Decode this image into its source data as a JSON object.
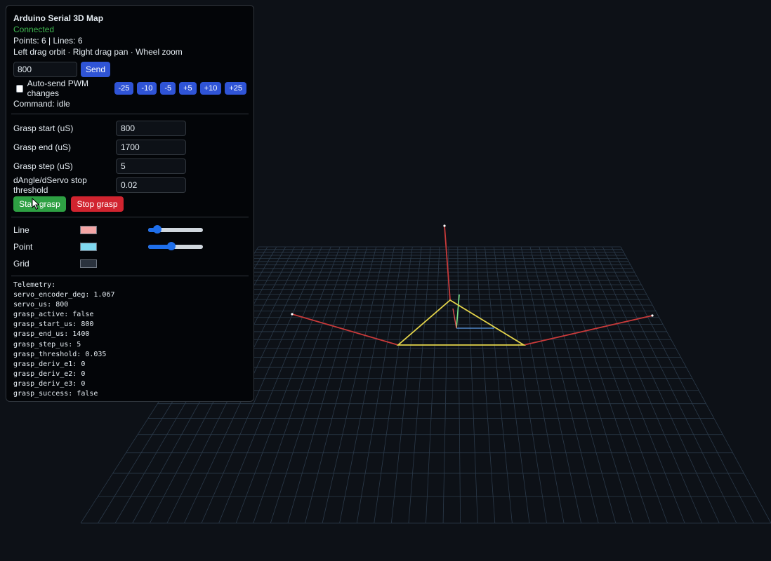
{
  "panel": {
    "title": "Arduino Serial 3D Map",
    "status": "Connected",
    "counts": "Points: 6 | Lines: 6",
    "help": "Left drag orbit · Right drag pan · Wheel zoom",
    "pwm_value": "800",
    "send_label": "Send",
    "auto_send_label": "Auto-send PWM changes",
    "auto_send_checked": false,
    "step_buttons": [
      "-25",
      "-10",
      "-5",
      "+5",
      "+10",
      "+25"
    ],
    "command_text": "Command: idle",
    "grasp_fields": [
      {
        "label": "Grasp start (uS)",
        "value": "800"
      },
      {
        "label": "Grasp end (uS)",
        "value": "1700"
      },
      {
        "label": "Grasp step (uS)",
        "value": "5"
      },
      {
        "label": "dAngle/dServo stop threshold",
        "value": "0.02"
      }
    ],
    "start_grasp_label": "Start grasp",
    "stop_grasp_label": "Stop grasp",
    "colors": [
      {
        "label": "Line",
        "color": "#f4a6a6",
        "slider_fraction": 0.17
      },
      {
        "label": "Point",
        "color": "#7fd8f0",
        "slider_fraction": 0.42
      },
      {
        "label": "Grid",
        "color": "#2a323d"
      }
    ],
    "telemetry_header": "Telemetry:",
    "telemetry": [
      "servo_encoder_deg: 1.067",
      "servo_us: 800",
      "grasp_active: false",
      "grasp_start_us: 800",
      "grasp_end_us: 1400",
      "grasp_step_us: 5",
      "grasp_threshold: 0.035",
      "grasp_deriv_e1: 0",
      "grasp_deriv_e2: 0",
      "grasp_deriv_e3: 0",
      "grasp_success: false"
    ]
  },
  "scene": {
    "background": "#0d1117",
    "grid_color": "#2b3a4a",
    "axis_colors": {
      "x": "#4f86c6",
      "y": "#7ee787",
      "z": "#e05050"
    },
    "line_color_red": "#c83a3a",
    "line_color_yellow": "#e3d34a"
  }
}
